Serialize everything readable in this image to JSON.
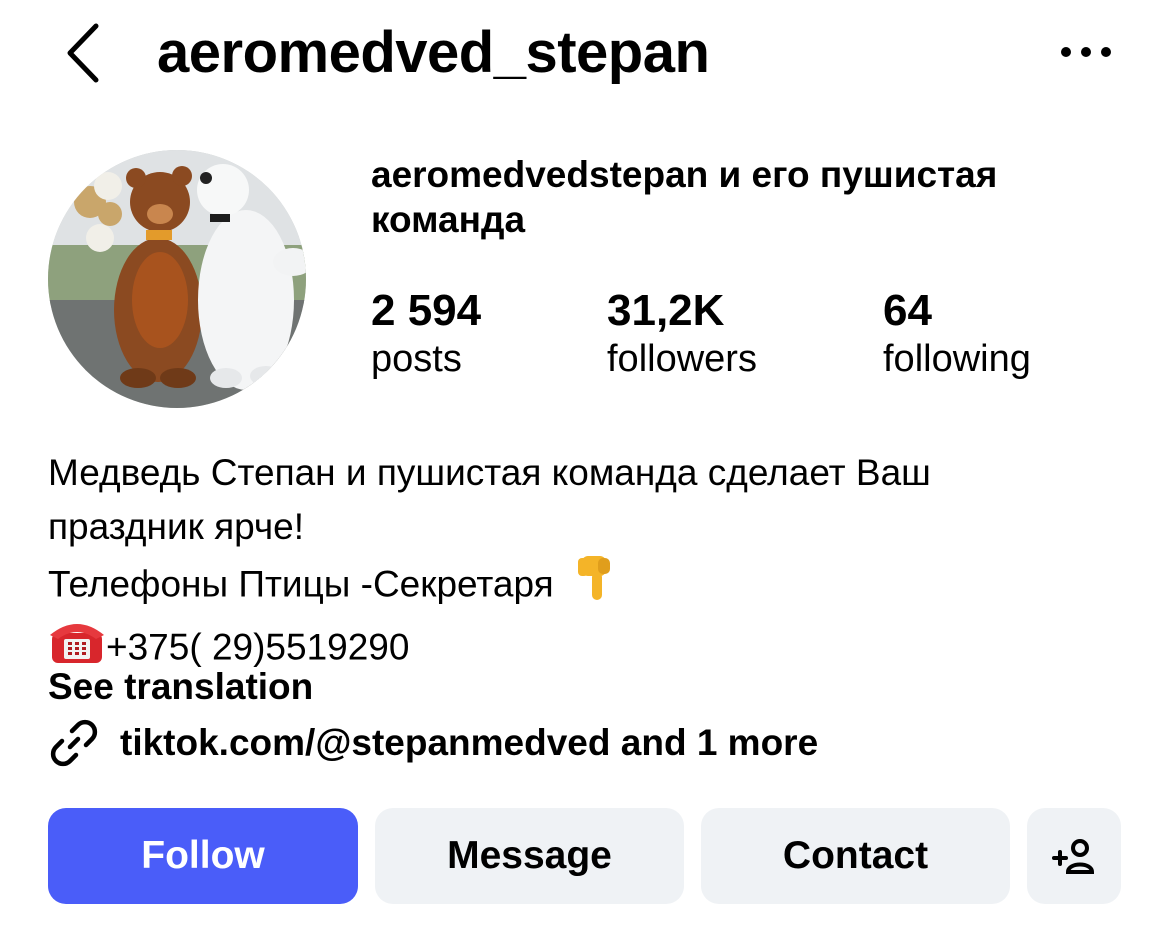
{
  "header": {
    "username": "aeromedved_stepan",
    "back_icon": "chevron-left-icon",
    "more_icon": "more-horizontal-icon"
  },
  "profile": {
    "full_name": "aeromedvedstepan и его пушистая команда",
    "avatar": "avatar-photo-bear-and-polar-bear-mascots"
  },
  "stats": [
    {
      "value": "2 594",
      "label": "posts"
    },
    {
      "value": "31,2K",
      "label": "followers"
    },
    {
      "value": "64",
      "label": "following"
    }
  ],
  "bio": {
    "line1": "Медведь Степан и пушистая команда сделает Ваш",
    "line2": "праздник ярче!",
    "line3": "Телефоны Птицы -Секретаря",
    "line3_emoji": "pointing-down-hand-emoji",
    "line4_emoji": "telephone-emoji",
    "line4": "+375( 29)5519290"
  },
  "see_translation": "See translation",
  "link": {
    "icon": "link-icon",
    "text": "tiktok.com/@stepanmedved and 1 more"
  },
  "actions": {
    "follow": "Follow",
    "message": "Message",
    "contact": "Contact",
    "add_person_icon": "add-person-icon"
  },
  "colors": {
    "follow_bg": "#4a5df9",
    "secondary_btn_bg": "#eff2f5",
    "text": "#000000"
  }
}
